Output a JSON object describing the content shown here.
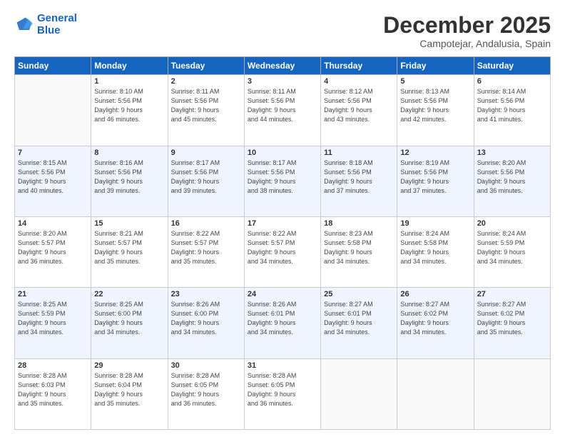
{
  "header": {
    "logo_line1": "General",
    "logo_line2": "Blue",
    "month": "December 2025",
    "location": "Campotejar, Andalusia, Spain"
  },
  "weekdays": [
    "Sunday",
    "Monday",
    "Tuesday",
    "Wednesday",
    "Thursday",
    "Friday",
    "Saturday"
  ],
  "weeks": [
    [
      {
        "day": "",
        "info": ""
      },
      {
        "day": "1",
        "info": "Sunrise: 8:10 AM\nSunset: 5:56 PM\nDaylight: 9 hours\nand 46 minutes."
      },
      {
        "day": "2",
        "info": "Sunrise: 8:11 AM\nSunset: 5:56 PM\nDaylight: 9 hours\nand 45 minutes."
      },
      {
        "day": "3",
        "info": "Sunrise: 8:11 AM\nSunset: 5:56 PM\nDaylight: 9 hours\nand 44 minutes."
      },
      {
        "day": "4",
        "info": "Sunrise: 8:12 AM\nSunset: 5:56 PM\nDaylight: 9 hours\nand 43 minutes."
      },
      {
        "day": "5",
        "info": "Sunrise: 8:13 AM\nSunset: 5:56 PM\nDaylight: 9 hours\nand 42 minutes."
      },
      {
        "day": "6",
        "info": "Sunrise: 8:14 AM\nSunset: 5:56 PM\nDaylight: 9 hours\nand 41 minutes."
      }
    ],
    [
      {
        "day": "7",
        "info": "Sunrise: 8:15 AM\nSunset: 5:56 PM\nDaylight: 9 hours\nand 40 minutes."
      },
      {
        "day": "8",
        "info": "Sunrise: 8:16 AM\nSunset: 5:56 PM\nDaylight: 9 hours\nand 39 minutes."
      },
      {
        "day": "9",
        "info": "Sunrise: 8:17 AM\nSunset: 5:56 PM\nDaylight: 9 hours\nand 39 minutes."
      },
      {
        "day": "10",
        "info": "Sunrise: 8:17 AM\nSunset: 5:56 PM\nDaylight: 9 hours\nand 38 minutes."
      },
      {
        "day": "11",
        "info": "Sunrise: 8:18 AM\nSunset: 5:56 PM\nDaylight: 9 hours\nand 37 minutes."
      },
      {
        "day": "12",
        "info": "Sunrise: 8:19 AM\nSunset: 5:56 PM\nDaylight: 9 hours\nand 37 minutes."
      },
      {
        "day": "13",
        "info": "Sunrise: 8:20 AM\nSunset: 5:56 PM\nDaylight: 9 hours\nand 36 minutes."
      }
    ],
    [
      {
        "day": "14",
        "info": "Sunrise: 8:20 AM\nSunset: 5:57 PM\nDaylight: 9 hours\nand 36 minutes."
      },
      {
        "day": "15",
        "info": "Sunrise: 8:21 AM\nSunset: 5:57 PM\nDaylight: 9 hours\nand 35 minutes."
      },
      {
        "day": "16",
        "info": "Sunrise: 8:22 AM\nSunset: 5:57 PM\nDaylight: 9 hours\nand 35 minutes."
      },
      {
        "day": "17",
        "info": "Sunrise: 8:22 AM\nSunset: 5:57 PM\nDaylight: 9 hours\nand 34 minutes."
      },
      {
        "day": "18",
        "info": "Sunrise: 8:23 AM\nSunset: 5:58 PM\nDaylight: 9 hours\nand 34 minutes."
      },
      {
        "day": "19",
        "info": "Sunrise: 8:24 AM\nSunset: 5:58 PM\nDaylight: 9 hours\nand 34 minutes."
      },
      {
        "day": "20",
        "info": "Sunrise: 8:24 AM\nSunset: 5:59 PM\nDaylight: 9 hours\nand 34 minutes."
      }
    ],
    [
      {
        "day": "21",
        "info": "Sunrise: 8:25 AM\nSunset: 5:59 PM\nDaylight: 9 hours\nand 34 minutes."
      },
      {
        "day": "22",
        "info": "Sunrise: 8:25 AM\nSunset: 6:00 PM\nDaylight: 9 hours\nand 34 minutes."
      },
      {
        "day": "23",
        "info": "Sunrise: 8:26 AM\nSunset: 6:00 PM\nDaylight: 9 hours\nand 34 minutes."
      },
      {
        "day": "24",
        "info": "Sunrise: 8:26 AM\nSunset: 6:01 PM\nDaylight: 9 hours\nand 34 minutes."
      },
      {
        "day": "25",
        "info": "Sunrise: 8:27 AM\nSunset: 6:01 PM\nDaylight: 9 hours\nand 34 minutes."
      },
      {
        "day": "26",
        "info": "Sunrise: 8:27 AM\nSunset: 6:02 PM\nDaylight: 9 hours\nand 34 minutes."
      },
      {
        "day": "27",
        "info": "Sunrise: 8:27 AM\nSunset: 6:02 PM\nDaylight: 9 hours\nand 35 minutes."
      }
    ],
    [
      {
        "day": "28",
        "info": "Sunrise: 8:28 AM\nSunset: 6:03 PM\nDaylight: 9 hours\nand 35 minutes."
      },
      {
        "day": "29",
        "info": "Sunrise: 8:28 AM\nSunset: 6:04 PM\nDaylight: 9 hours\nand 35 minutes."
      },
      {
        "day": "30",
        "info": "Sunrise: 8:28 AM\nSunset: 6:05 PM\nDaylight: 9 hours\nand 36 minutes."
      },
      {
        "day": "31",
        "info": "Sunrise: 8:28 AM\nSunset: 6:05 PM\nDaylight: 9 hours\nand 36 minutes."
      },
      {
        "day": "",
        "info": ""
      },
      {
        "day": "",
        "info": ""
      },
      {
        "day": "",
        "info": ""
      }
    ]
  ]
}
